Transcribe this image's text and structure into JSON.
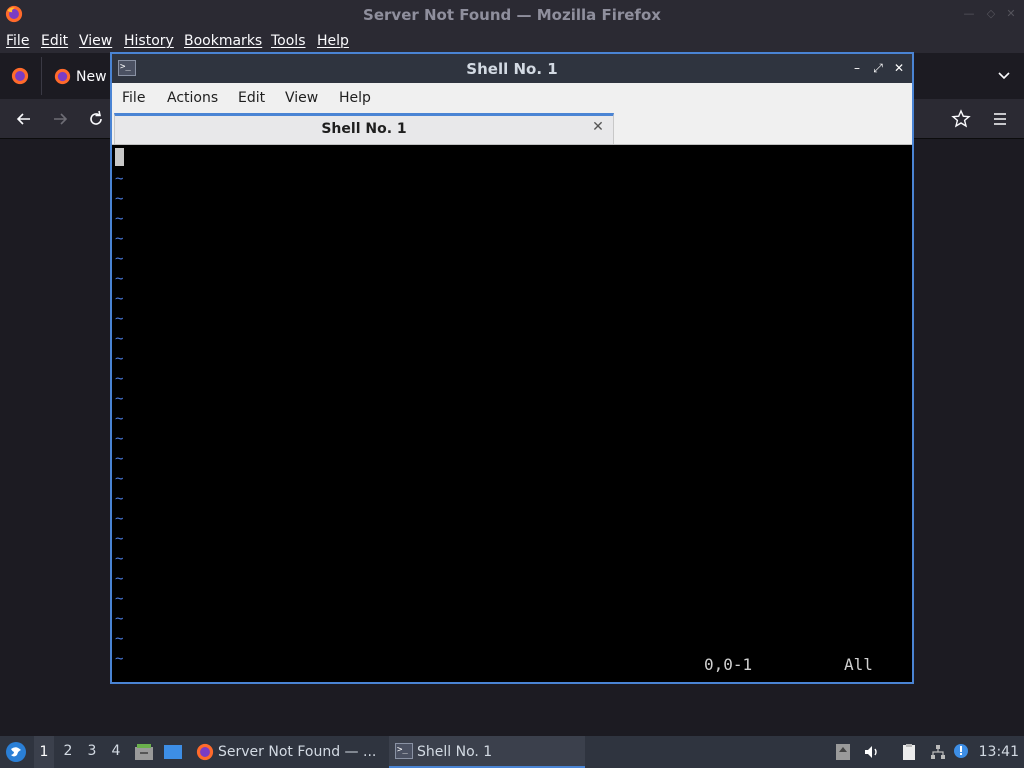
{
  "firefox": {
    "window_title": "Server Not Found — Mozilla Firefox",
    "menu": [
      "File",
      "Edit",
      "View",
      "History",
      "Bookmarks",
      "Tools",
      "Help"
    ],
    "tab_label": "New",
    "icons": {
      "logo": "firefox-icon",
      "back": "arrow-left-icon",
      "forward": "arrow-right-icon",
      "reload": "reload-icon",
      "bookmark": "star-icon",
      "app_menu": "hamburger-icon",
      "tab_list": "chevron-down-icon"
    }
  },
  "terminal": {
    "window_title": "Shell No. 1",
    "menu": [
      "File",
      "Actions",
      "Edit",
      "View",
      "Help"
    ],
    "tab_label": "Shell No. 1",
    "tilde_count": 25,
    "tilde_char": "~",
    "status_position": "0,0-1",
    "status_scroll": "All",
    "colors": {
      "tilde": "#4a7be0",
      "accent": "#4a84d4"
    }
  },
  "taskbar": {
    "workspaces": [
      "1",
      "2",
      "3",
      "4"
    ],
    "active_workspace": "1",
    "tasks": [
      {
        "label": "Server Not Found — ...",
        "icon": "firefox-icon"
      },
      {
        "label": "Shell No. 1",
        "icon": "terminal-icon"
      }
    ],
    "clock": "13:41"
  }
}
